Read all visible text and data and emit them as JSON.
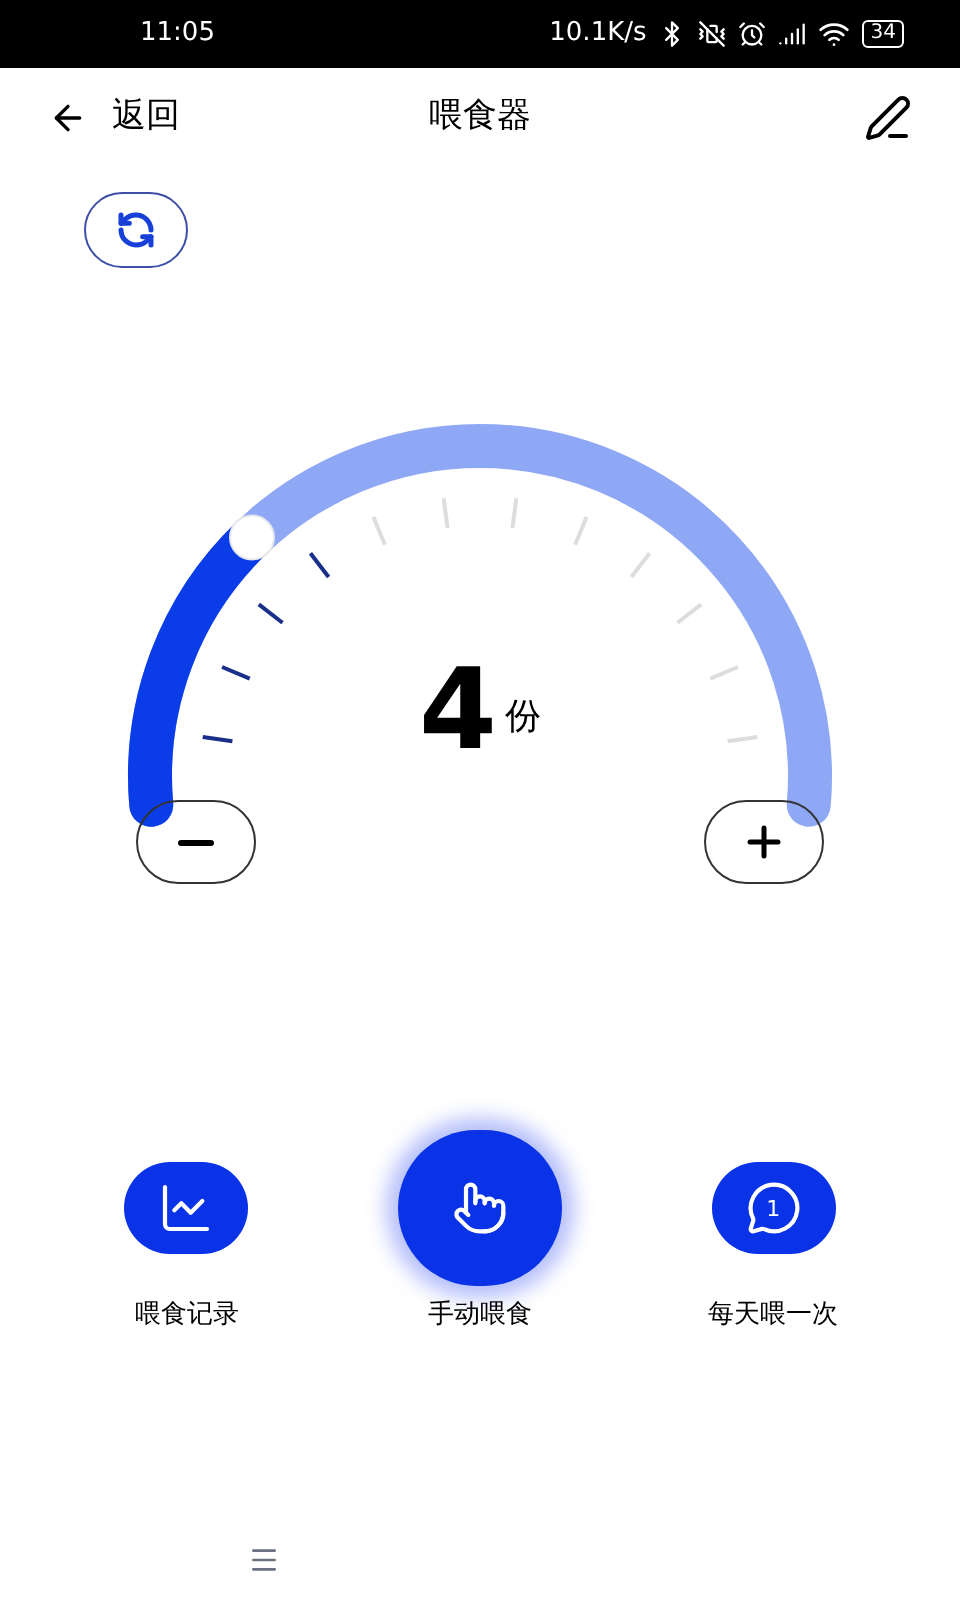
{
  "status_bar": {
    "time": "11:05",
    "speed": "10.1K/s",
    "battery": "34"
  },
  "header": {
    "back_label": "返回",
    "title": "喂食器"
  },
  "gauge": {
    "value": "4",
    "unit": "份"
  },
  "actions": [
    {
      "label": "喂食记录",
      "selected": false
    },
    {
      "label": "手动喂食",
      "selected": true
    },
    {
      "label": "每天喂一次",
      "selected": false,
      "icon_text": "1"
    }
  ]
}
